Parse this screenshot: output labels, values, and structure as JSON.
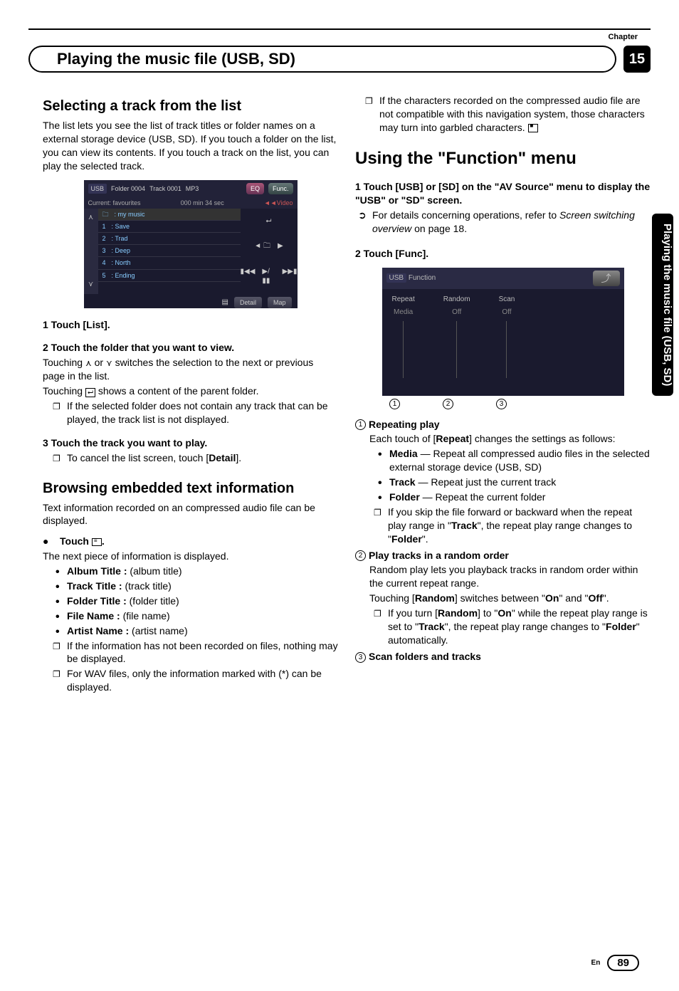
{
  "chapter_label": "Chapter",
  "chapter_number": "15",
  "header_title": "Playing the music file (USB, SD)",
  "side_tab": "Playing the music file (USB, SD)",
  "left": {
    "h_select": "Selecting a track from the list",
    "p_select": "The list lets you see the list of track titles or folder names on a external storage device (USB, SD). If you touch a folder on the list, you can view its contents. If you touch a track on the list, you can play the selected track.",
    "step1": "1    Touch [List].",
    "step2": "2    Touch the folder that you want to view.",
    "p2a": "Touching ",
    "p2a_mid": " or ",
    "p2a_end": " switches the selection to the next or previous page in the list.",
    "p2b_pre": "Touching ",
    "p2b_post": " shows a content of the parent folder.",
    "note2": "If the selected folder does not contain any track that can be played, the track list is not displayed.",
    "step3": "3    Touch the track you want to play.",
    "note3_pre": "To cancel the list screen, touch [",
    "note3_bold": "Detail",
    "note3_post": "].",
    "h_browse": "Browsing embedded text information",
    "p_browse": "Text information recorded on an compressed audio file can be displayed.",
    "touch_step_pre": "Touch ",
    "touch_step_post": ".",
    "p_next": "The next piece of information is displayed.",
    "info_items": [
      {
        "b": "Album Title :",
        "t": " (album title)"
      },
      {
        "b": "Track Title :",
        "t": " (track title)"
      },
      {
        "b": "Folder Title :",
        "t": " (folder title)"
      },
      {
        "b": "File Name :",
        "t": " (file name)"
      },
      {
        "b": "Artist Name :",
        "t": " (artist name)"
      }
    ],
    "note_a": "If the information has not been recorded on files, nothing may be displayed.",
    "note_b": "For WAV files, only the information marked with (*) can be displayed."
  },
  "right": {
    "top_note": "If the characters recorded on the compressed audio file are not compatible with this navigation system, those characters may turn into garbled characters.",
    "h_func_pre": "Using the \"",
    "h_func_mid": "Function",
    "h_func_post": "\" menu",
    "step1": "1    Touch [USB] or [SD] on the \"AV Source\" menu to display the \"USB\" or \"SD\" screen.",
    "arrow_pre": "For details concerning operations, refer to ",
    "arrow_it": "Screen switching overview",
    "arrow_post": " on page 18.",
    "step2": "2    Touch [Func].",
    "f1_title": "Repeating play",
    "f1_body_a": "Each touch of [",
    "f1_body_b": "Repeat",
    "f1_body_c": "] changes the settings as follows:",
    "f1_items": [
      {
        "b": "Media",
        "t": " — Repeat all compressed audio files in the selected external storage device (USB, SD)"
      },
      {
        "b": "Track",
        "t": " — Repeat just the current track"
      },
      {
        "b": "Folder",
        "t": " — Repeat the current folder"
      }
    ],
    "f1_note_a": "If you skip the file forward or backward when the repeat play range in \"",
    "f1_note_b": "Track",
    "f1_note_c": "\", the repeat play range changes to \"",
    "f1_note_d": "Folder",
    "f1_note_e": "\".",
    "f2_title": "Play tracks in a random order",
    "f2_body": "Random play lets you playback tracks in random order within the current repeat range.",
    "f2_body2_a": "Touching [",
    "f2_body2_b": "Random",
    "f2_body2_c": "] switches between \"",
    "f2_body2_d": "On",
    "f2_body2_e": "\" and \"",
    "f2_body2_f": "Off",
    "f2_body2_g": "\".",
    "f2_note_a": "If you turn [",
    "f2_note_b": "Random",
    "f2_note_c": "] to \"",
    "f2_note_d": "On",
    "f2_note_e": "\" while the repeat play range is set to \"",
    "f2_note_f": "Track",
    "f2_note_g": "\", the repeat play range changes to \"",
    "f2_note_h": "Folder",
    "f2_note_i": "\" automatically.",
    "f3_title": "Scan folders and tracks"
  },
  "shot1": {
    "usb": "USB",
    "folder": "Folder 0004",
    "track": "Track 0001",
    "mp3": "MP3",
    "eq": "EQ",
    "func": "Func.",
    "current": "Current: favourites",
    "time": "000 min 34 sec",
    "video": "◄◄Video",
    "rows": [
      {
        "n": "",
        "icon": "🗀",
        "t": ": my music"
      },
      {
        "n": "1",
        "icon": "",
        "t": ": Save"
      },
      {
        "n": "2",
        "icon": "",
        "t": ": Trad"
      },
      {
        "n": "3",
        "icon": "",
        "t": ": Deep"
      },
      {
        "n": "4",
        "icon": "",
        "t": ": North"
      },
      {
        "n": "5",
        "icon": "",
        "t": ": Ending"
      }
    ],
    "detail": "Detail",
    "map": "Map"
  },
  "shot2": {
    "usb": "USB",
    "title": "Function",
    "repeat": "Repeat",
    "random": "Random",
    "scan": "Scan",
    "media": "Media",
    "off1": "Off",
    "off2": "Off"
  },
  "footer": {
    "en": "En",
    "page": "89"
  }
}
